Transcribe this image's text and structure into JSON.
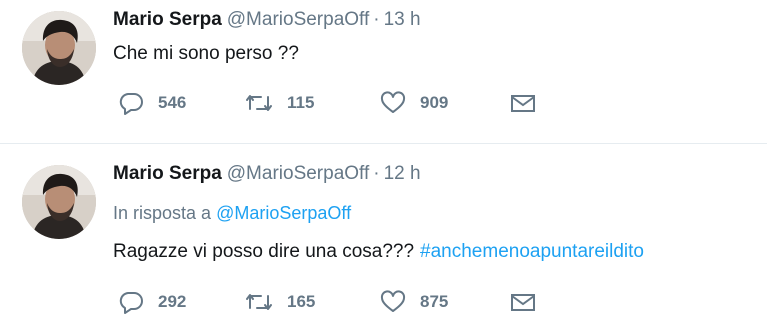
{
  "tweets": [
    {
      "author_name": "Mario Serpa",
      "handle": "@MarioSerpaOff",
      "separator": "·",
      "time": "13 h",
      "reply_to_prefix": "",
      "reply_to_handle": "",
      "text": "Che mi sono perso ??",
      "hashtag": "",
      "replies": "546",
      "retweets": "115",
      "likes": "909"
    },
    {
      "author_name": "Mario Serpa",
      "handle": "@MarioSerpaOff",
      "separator": "·",
      "time": "12 h",
      "reply_to_prefix": "In risposta a",
      "reply_to_handle": "@MarioSerpaOff",
      "text": "Ragazze vi posso dire una cosa???",
      "hashtag": "#anchemenoapuntareildito",
      "replies": "292",
      "retweets": "165",
      "likes": "875"
    }
  ],
  "icons": {
    "reply": "reply-icon",
    "retweet": "retweet-icon",
    "like": "heart-icon",
    "dm": "envelope-icon"
  },
  "colors": {
    "link": "#1da1f2",
    "secondary_text": "#657786",
    "primary_text": "#14171a",
    "divider": "#e6ecf0"
  }
}
